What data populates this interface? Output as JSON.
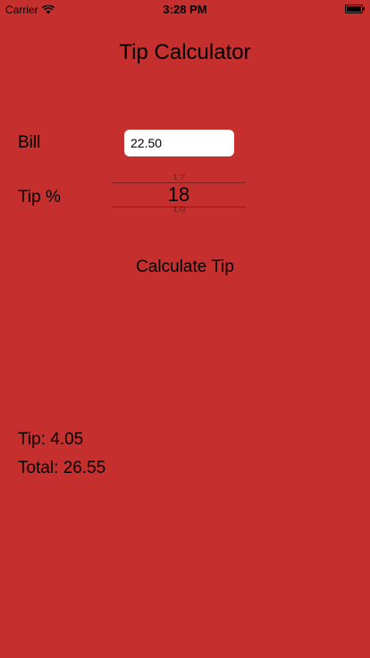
{
  "status_bar": {
    "carrier": "Carrier",
    "time": "3:28 PM",
    "icons": [
      "wifi-icon",
      "battery-icon"
    ]
  },
  "app": {
    "title": "Tip Calculator",
    "background_color": "#c5302f"
  },
  "form": {
    "bill_label": "Bill",
    "bill_value": "22.50",
    "tip_label": "Tip %",
    "tip_picker": {
      "previous": "17",
      "selected": "18",
      "next": "19"
    },
    "calculate_label": "Calculate Tip"
  },
  "results": {
    "tip_text": "Tip: 4.05",
    "total_text": "Total: 26.55"
  }
}
